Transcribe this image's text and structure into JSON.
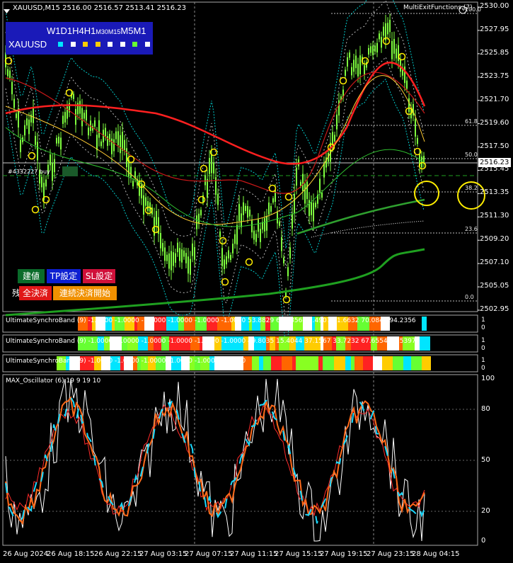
{
  "header": {
    "symbol_line": "XAUUSD,M15  2516.00 2516.57 2513.41 2516.23",
    "indicator_name": "MultiExitFunctions (7)"
  },
  "timeframes": {
    "labels": [
      "W1",
      "D1",
      "H4",
      "H1",
      "M30",
      "M15",
      "M5",
      "M1"
    ],
    "symbol": "XAUUSD",
    "square_colors": [
      "#00e5ff",
      "#ffffff",
      "#ffcc00",
      "#ffcc00",
      "#ffffff",
      "#ffffff",
      "#66ff33",
      "#ffffff"
    ]
  },
  "price_axis": {
    "labels": [
      "2530.00",
      "2527.95",
      "2525.85",
      "2523.75",
      "2521.70",
      "2519.60",
      "2517.50",
      "2515.45",
      "2513.35",
      "2511.30",
      "2509.20",
      "2507.10",
      "2505.05",
      "2502.95"
    ],
    "current_price": "2516.23"
  },
  "fibonacci": {
    "levels": [
      "100.0",
      "61.8",
      "50.0",
      "38.2",
      "23.6",
      "0.0"
    ]
  },
  "order_line": {
    "label": "#4332227 buy"
  },
  "buttons": {
    "entry": "建値",
    "tp": "TP設定",
    "sl": "SL設定",
    "close_all": "全決済",
    "continuous": "連続決済開始",
    "partial_hidden": "残"
  },
  "bands": [
    {
      "title": "UltimateSynchroBand (9) -1.0000 -1.0000 -1.0000 -1.0000 -1.0000 -1.0000 53.8829 64.5856 73.4907 61.6632 70.0849 94.2356",
      "top": "1",
      "bottom": "0"
    },
    {
      "title": "UltimateSynchroBand (9) -1.0000 -1.0000 -1.0000 -1.0000 -1.0000 -1.0000 49.8035 15.4044 37.1567 33.7232 67.6554 63.5397",
      "top": "1",
      "bottom": "0"
    },
    {
      "title": "UltimateSynchroBand (9) -1.0000 -1.0000 -1.0000 -1.0000 -1.0000 -1.0000",
      "top": "1",
      "bottom": "0"
    }
  ],
  "oscillator": {
    "title": "MAX_Oscillator (6) 19 9 19 10",
    "levels": [
      "100",
      "80",
      "50",
      "20",
      "0"
    ]
  },
  "time_axis": {
    "labels": [
      "26 Aug 2024",
      "26 Aug 18:15",
      "26 Aug 22:15",
      "27 Aug 03:15",
      "27 Aug 07:15",
      "27 Aug 11:15",
      "27 Aug 15:15",
      "27 Aug 19:15",
      "27 Aug 23:15",
      "28 Aug 04:15"
    ]
  },
  "colors": {
    "candle": "#7fff3f",
    "ma_red": "#ff2020",
    "ma_green": "#1fa020",
    "bollinger": "#00cccc",
    "signal_circle": "#ffee00"
  }
}
